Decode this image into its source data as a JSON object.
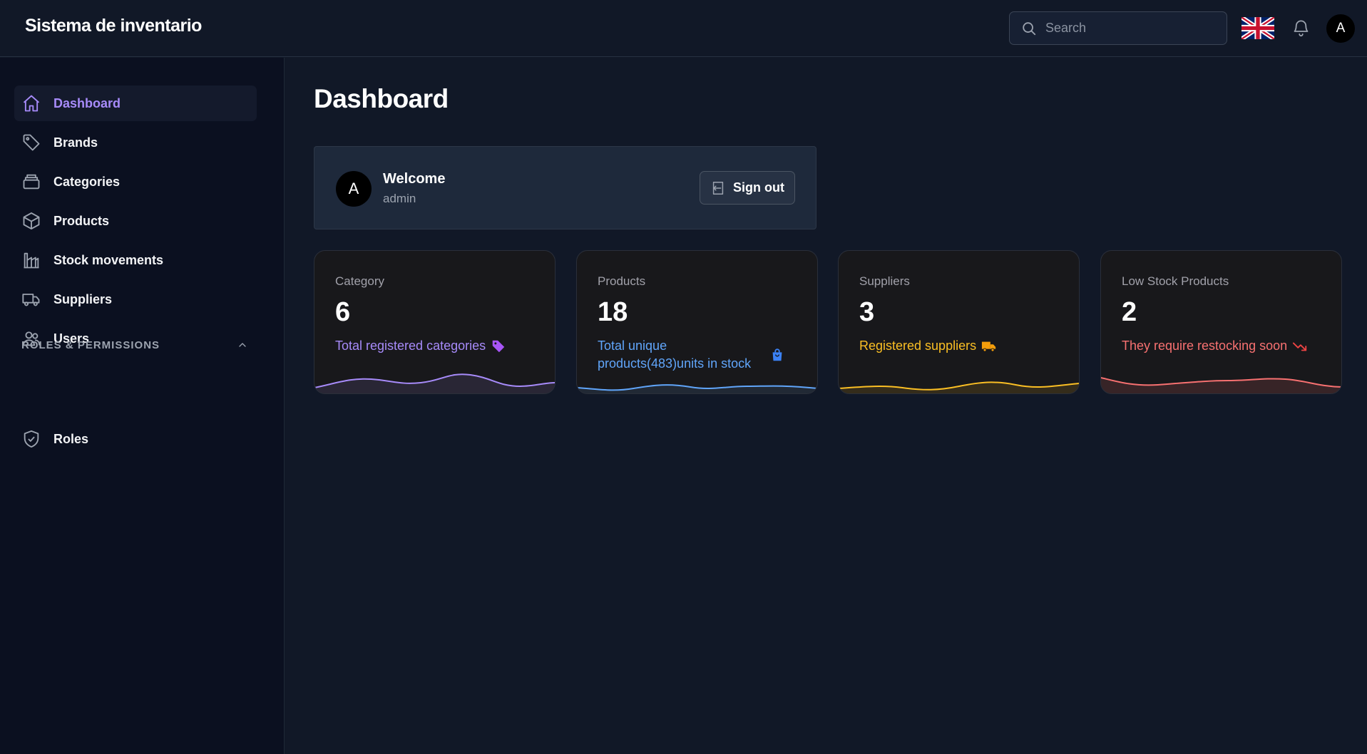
{
  "app": {
    "title": "Sistema de inventario"
  },
  "header": {
    "search_placeholder": "Search",
    "language_icon": "uk-flag-icon",
    "notification_icon": "bell-icon",
    "avatar_initial": "A"
  },
  "sidebar": {
    "items": [
      {
        "label": "Dashboard",
        "icon": "home-icon",
        "active": true
      },
      {
        "label": "Brands",
        "icon": "tag-icon"
      },
      {
        "label": "Categories",
        "icon": "archive-icon"
      },
      {
        "label": "Products",
        "icon": "cube-icon"
      },
      {
        "label": "Stock movements",
        "icon": "building-chart-icon"
      },
      {
        "label": "Suppliers",
        "icon": "truck-icon"
      },
      {
        "label": "Users",
        "icon": "users-icon"
      }
    ],
    "section": {
      "title": "ROLES & PERMISSIONS",
      "expanded": true
    },
    "section_items": [
      {
        "label": "Roles",
        "icon": "shield-check-icon"
      }
    ]
  },
  "main": {
    "title": "Dashboard",
    "welcome": {
      "avatar_initial": "A",
      "title": "Welcome",
      "username": "admin",
      "signout_label": "Sign out"
    },
    "stats": [
      {
        "label": "Category",
        "value": "6",
        "description": "Total registered categories",
        "icon": "tag-icon",
        "color": "#a78bfa"
      },
      {
        "label": "Products",
        "value": "18",
        "description_line1": "Total unique",
        "description_line2": "products(483)units in stock",
        "icon": "shopping-bag-icon",
        "color": "#60a5fa"
      },
      {
        "label": "Suppliers",
        "value": "3",
        "description": "Registered suppliers",
        "icon": "truck-icon",
        "color": "#fbbf24"
      },
      {
        "label": "Low Stock Products",
        "value": "2",
        "description": "They require restocking soon",
        "icon": "trending-down-icon",
        "color": "#f87171"
      }
    ]
  },
  "colors": {
    "accent": "#a78bfa",
    "background": "#111827",
    "sidebar": "#0b1020",
    "card": "#18181b"
  }
}
